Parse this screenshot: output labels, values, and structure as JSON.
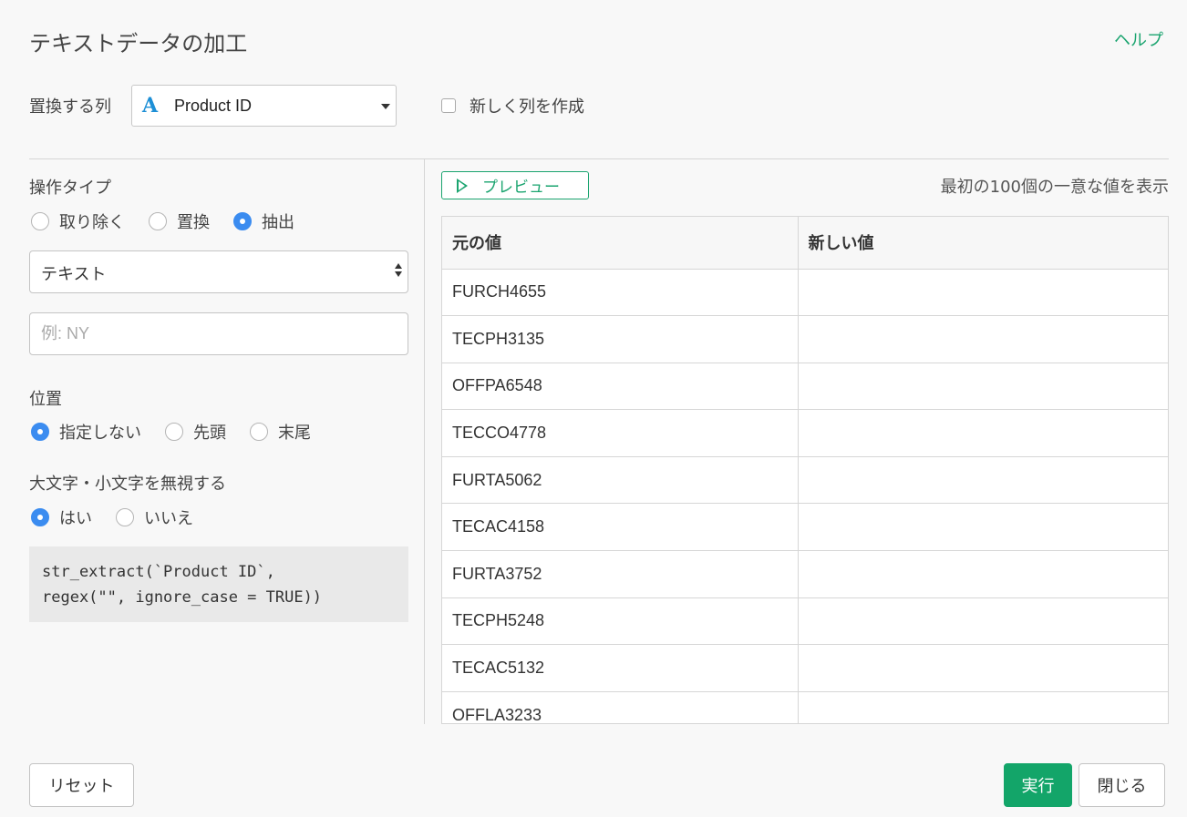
{
  "header": {
    "title": "テキストデータの加工",
    "help_label": "ヘルプ"
  },
  "column": {
    "label": "置換する列",
    "type_icon": "A",
    "selected": "Product ID",
    "new_column_label": "新しく列を作成",
    "new_column_checked": false
  },
  "operation": {
    "label": "操作タイプ",
    "options": [
      "取り除く",
      "置換",
      "抽出"
    ],
    "selected": "抽出"
  },
  "match_type": {
    "value": "テキスト"
  },
  "pattern": {
    "value": "",
    "placeholder": "例: NY"
  },
  "position": {
    "label": "位置",
    "options": [
      "指定しない",
      "先頭",
      "末尾"
    ],
    "selected": "指定しない"
  },
  "ignore_case": {
    "label": "大文字・小文字を無視する",
    "options": [
      "はい",
      "いいえ"
    ],
    "selected": "はい"
  },
  "code": "str_extract(`Product ID`,\nregex(\"\", ignore_case = TRUE))",
  "preview": {
    "button_label": "プレビュー",
    "note": "最初の100個の一意な値を表示",
    "columns": [
      "元の値",
      "新しい値"
    ],
    "rows": [
      [
        "FURCH4655",
        ""
      ],
      [
        "TECPH3135",
        ""
      ],
      [
        "OFFPA6548",
        ""
      ],
      [
        "TECCO4778",
        ""
      ],
      [
        "FURTA5062",
        ""
      ],
      [
        "TECAC4158",
        ""
      ],
      [
        "FURTA3752",
        ""
      ],
      [
        "TECPH5248",
        ""
      ],
      [
        "TECAC5132",
        ""
      ],
      [
        "OFFLA3233",
        ""
      ]
    ]
  },
  "footer": {
    "reset_label": "リセット",
    "run_label": "実行",
    "close_label": "閉じる"
  },
  "colors": {
    "accent": "#13a569",
    "radio_selected": "#3b8cf0",
    "type_icon": "#1d8fd6"
  }
}
